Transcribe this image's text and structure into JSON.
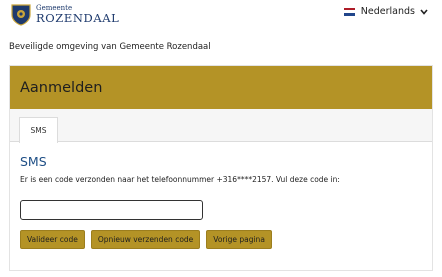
{
  "header": {
    "brand_prefix": "Gemeente",
    "brand_name": "ROZENDAAL",
    "language": "Nederlands"
  },
  "notice": "Beveiligde omgeving van Gemeente Rozendaal",
  "panel": {
    "title": "Aanmelden",
    "tabs": [
      {
        "label": "SMS"
      }
    ]
  },
  "sms": {
    "heading": "SMS",
    "info": "Er is een code verzonden naar het telefoonnummer +316****2157. Vul deze code in:",
    "code_value": "",
    "buttons": {
      "validate": "Valideer code",
      "resend": "Opnieuw verzenden code",
      "previous": "Vorige pagina"
    }
  },
  "colors": {
    "accent": "#b49326",
    "heading_blue": "#1f4f86",
    "brand_navy": "#1e3a6d"
  },
  "icons": {
    "crest": "shield-crest-icon",
    "flag": "netherlands-flag-icon",
    "chevron": "chevron-down-icon"
  }
}
